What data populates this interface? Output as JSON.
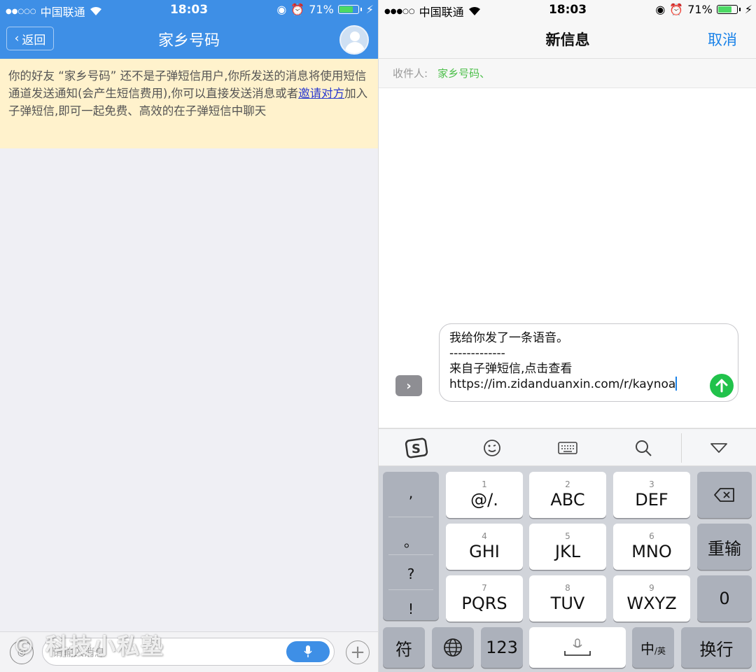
{
  "left": {
    "status": {
      "carrier": "中国联通",
      "time": "18:03",
      "battery": "71%"
    },
    "nav": {
      "back_label": "返回",
      "title": "家乡号码"
    },
    "notice": {
      "text_main": "你的好友 “家乡号码” 还不是子弹短信用户,你所发送的消息将使用短信通道发送通知(会产生短信费用),你可以直接发送消息或者",
      "link": "邀请对方",
      "text_tail": "加入子弹短信,即可一起免费、高效的在子弹短信中聊天"
    },
    "input": {
      "placeholder": "请输入消息"
    },
    "watermark": "© 科技小私塾"
  },
  "right": {
    "status": {
      "carrier": "中国联通",
      "time": "18:03",
      "battery": "71%"
    },
    "nav": {
      "title": "新信息",
      "cancel_label": "取消"
    },
    "to": {
      "label": "收件人:",
      "value": "家乡号码、"
    },
    "message": {
      "line1": "我给你发了一条语音。",
      "line2": "-------------",
      "line3": "来自子弹短信,点击查看",
      "line4": "https://im.zidanduanxin.com/r/kaynoa"
    },
    "keyboard": {
      "punct": [
        ",",
        "。",
        "?",
        "!"
      ],
      "keys": [
        {
          "num": "1",
          "label": "@/."
        },
        {
          "num": "2",
          "label": "ABC"
        },
        {
          "num": "3",
          "label": "DEF"
        },
        {
          "num": "4",
          "label": "GHI"
        },
        {
          "num": "5",
          "label": "JKL"
        },
        {
          "num": "6",
          "label": "MNO"
        },
        {
          "num": "7",
          "label": "PQRS"
        },
        {
          "num": "8",
          "label": "TUV"
        },
        {
          "num": "9",
          "label": "WXYZ"
        }
      ],
      "retype": "重输",
      "zero": "0",
      "symbols": "符",
      "numbers": "123",
      "lang_main": "中",
      "lang_sub": "英",
      "return": "换行"
    }
  }
}
